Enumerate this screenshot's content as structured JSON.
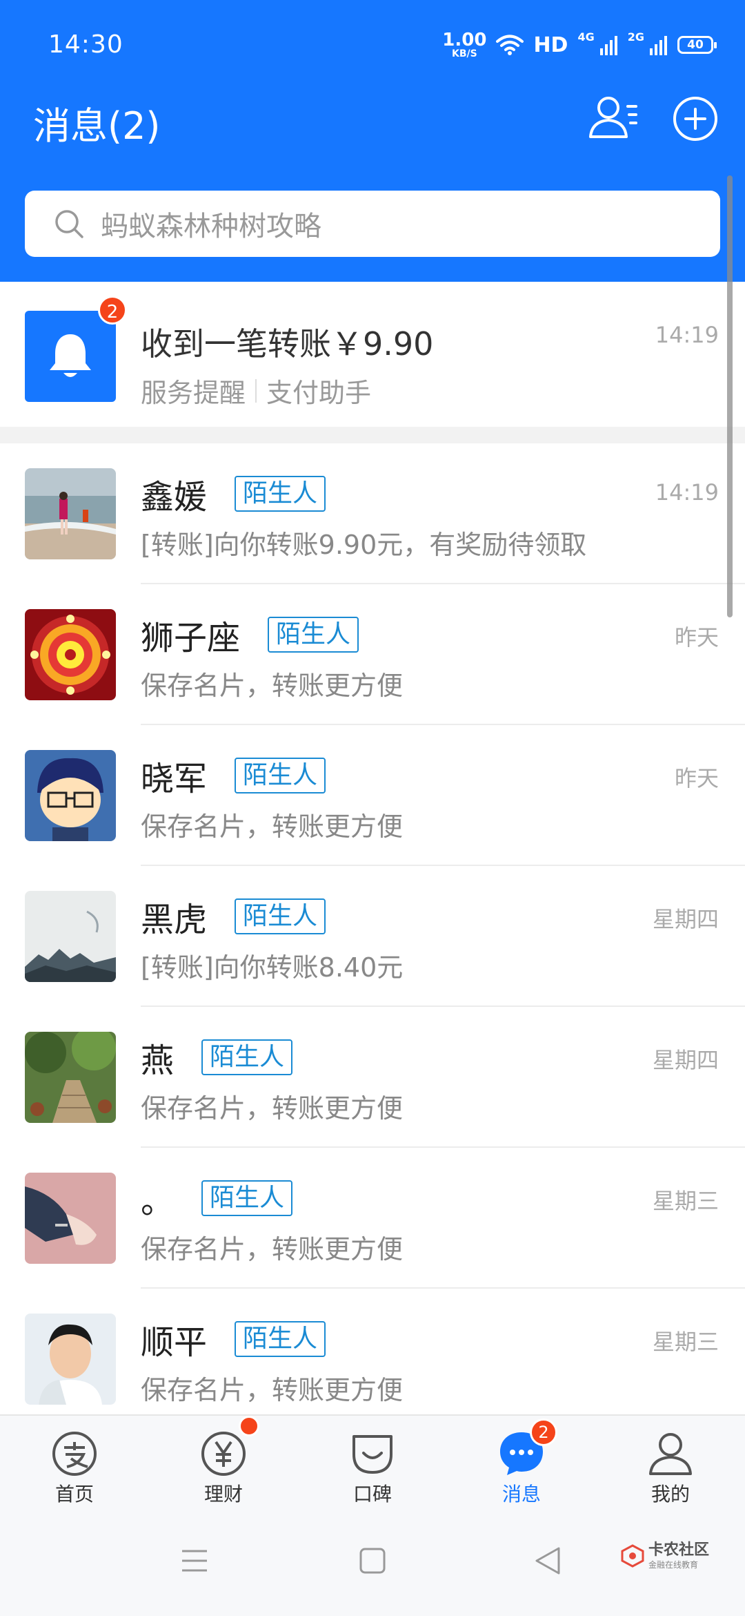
{
  "status_bar": {
    "time": "14:30",
    "speed_value": "1.00",
    "speed_unit": "KB/S",
    "hd_label": "HD",
    "net1": "4G",
    "net2": "2G",
    "battery": "40"
  },
  "header": {
    "title": "消息(2)",
    "contacts_icon": "contacts-icon",
    "add_icon": "plus-circle-icon",
    "background": "#1677ff"
  },
  "search": {
    "placeholder": "蚂蚁森林种树攻略"
  },
  "notification": {
    "badge": "2",
    "title": "收到一笔转账￥9.90",
    "category": "服务提醒",
    "source": "支付助手",
    "time": "14:19"
  },
  "chats": [
    {
      "name": "鑫媛",
      "tag": "陌生人",
      "message": "[转账]向你转账9.90元，有奖励待领取",
      "time": "14:19"
    },
    {
      "name": "狮子座",
      "tag": "陌生人",
      "message": "保存名片，转账更方便",
      "time": "昨天"
    },
    {
      "name": "晓军",
      "tag": "陌生人",
      "message": "保存名片，转账更方便",
      "time": "昨天"
    },
    {
      "name": "黑虎",
      "tag": "陌生人",
      "message": "[转账]向你转账8.40元",
      "time": "星期四"
    },
    {
      "name": "燕",
      "tag": "陌生人",
      "message": "保存名片，转账更方便",
      "time": "星期四"
    },
    {
      "name": "。",
      "tag": "陌生人",
      "message": "保存名片，转账更方便",
      "time": "星期三"
    },
    {
      "name": "顺平",
      "tag": "陌生人",
      "message": "保存名片，转账更方便",
      "time": "星期三"
    }
  ],
  "tabs": [
    {
      "label": "首页",
      "icon": "alipay-icon"
    },
    {
      "label": "理财",
      "icon": "yen-icon"
    },
    {
      "label": "口碑",
      "icon": "koubei-icon"
    },
    {
      "label": "消息",
      "icon": "message-icon",
      "badge": "2",
      "active": true
    },
    {
      "label": "我的",
      "icon": "person-icon"
    }
  ],
  "watermark": {
    "title": "卡农社区",
    "subtitle": "金融在线教育"
  },
  "colors": {
    "primary": "#1677ff",
    "badge": "#f5441a",
    "tag": "#1a8bd4"
  }
}
